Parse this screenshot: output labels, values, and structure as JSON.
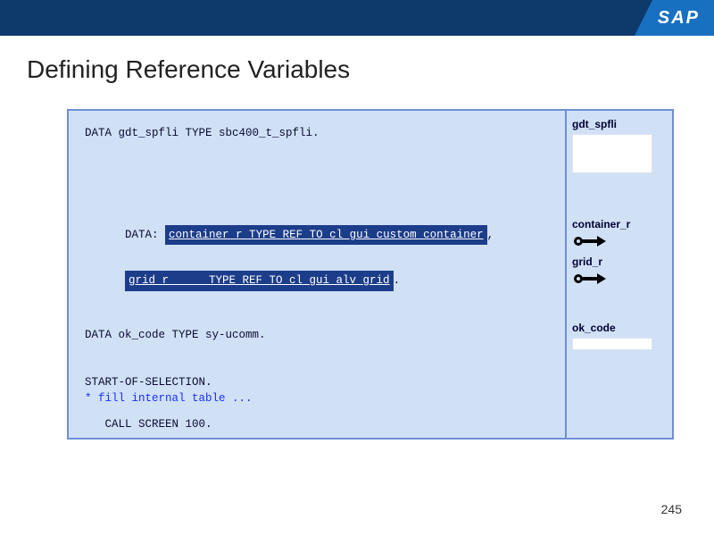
{
  "header": {
    "logo_text": "SAP"
  },
  "title": "Defining Reference Variables",
  "code": {
    "line1": "DATA gdt_spfli TYPE sbc400_t_spfli.",
    "data_prefix": "DATA:",
    "hl1": "container_r TYPE REF TO cl_gui_custom_container",
    "comma": ",",
    "hl2": "grid_r      TYPE REF TO cl_gui_alv_grid",
    "period": ".",
    "line3": "DATA ok_code TYPE sy-ucomm.",
    "line4": "START-OF-SELECTION.",
    "line5": "* fill internal table ...",
    "line6": "   CALL SCREEN 100."
  },
  "side": {
    "var1": "gdt_spfli",
    "var2": "container_r",
    "var3": "grid_r",
    "var4": "ok_code"
  },
  "page_number": "245"
}
